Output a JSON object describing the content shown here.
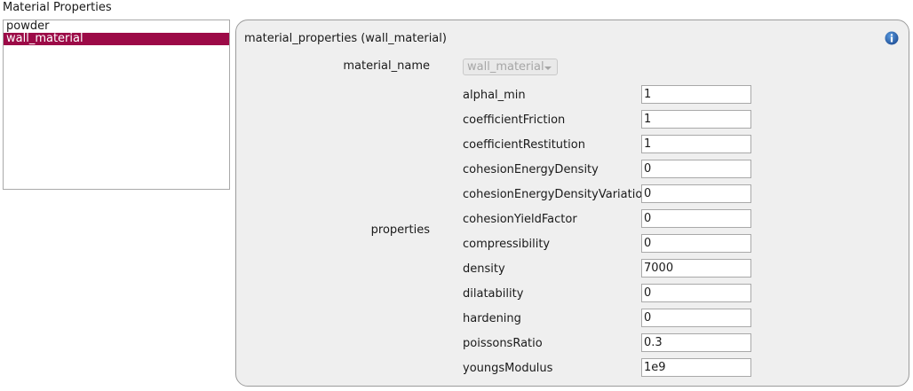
{
  "section_title": "Material Properties",
  "materials": [
    {
      "label": "powder",
      "selected": false
    },
    {
      "label": "wall_material",
      "selected": true
    }
  ],
  "panel": {
    "title": "material_properties (wall_material)",
    "material_name_label": "material_name",
    "material_name_value": "wall_material",
    "properties_label": "properties",
    "properties": [
      {
        "name": "alphal_min",
        "value": "1"
      },
      {
        "name": "coefficientFriction",
        "value": "1"
      },
      {
        "name": "coefficientRestitution",
        "value": "1"
      },
      {
        "name": "cohesionEnergyDensity",
        "value": "0"
      },
      {
        "name": "cohesionEnergyDensityVariation",
        "value": "0"
      },
      {
        "name": "cohesionYieldFactor",
        "value": "0"
      },
      {
        "name": "compressibility",
        "value": "0"
      },
      {
        "name": "density",
        "value": "7000"
      },
      {
        "name": "dilatability",
        "value": "0"
      },
      {
        "name": "hardening",
        "value": "0"
      },
      {
        "name": "poissonsRatio",
        "value": "0.3"
      },
      {
        "name": "youngsModulus",
        "value": "1e9"
      }
    ]
  },
  "colors": {
    "selection": "#9c0a47",
    "info_icon": "#1f5fa8"
  },
  "icons": {
    "info": "info-icon",
    "combo_arrow": "chevron-down-icon"
  }
}
